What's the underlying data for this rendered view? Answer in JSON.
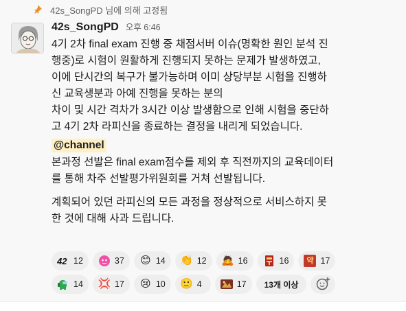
{
  "pinned": {
    "text": "42s_SongPD 님에 의해 고정됨"
  },
  "message": {
    "author": "42s_SongPD",
    "time": "오후 6:46",
    "paragraph1": "4기 2차 final exam 진행 중 채점서버 이슈(명확한 원인 분석 진\n행중)로 시험이 원활하게 진행되지 못하는 문제가 발생하였고,\n이에 단시간의 복구가 불가능하며 이미 상당부분 시험을 진행하\n신 교육생분과 아예 진행을 못하는 분의\n차이 및 시간 격차가 3시간 이상 발생함으로 인해 시험을 중단하\n고 4기 2차 라피신을 종료하는 결정을 내리게 되었습니다.",
    "mention": "@channel",
    "paragraph2": "본과정 선발은 final exam점수를 제외 후 직전까지의 교육데이터\n를 통해 차주 선발평가위원회를 거쳐 선발됩니다.",
    "paragraph3": "계획되어 있던 라피신의 모든 과정을 정상적으로 서비스하지 못\n한 것에 대해 사과 드립니다."
  },
  "reactions": [
    {
      "icon": "42-logo-icon",
      "glyph": "42",
      "count": "12"
    },
    {
      "icon": "pink-blob-icon",
      "glyph": "",
      "count": "37"
    },
    {
      "icon": "smile-icon",
      "glyph": "😊",
      "count": "14"
    },
    {
      "icon": "clap-icon",
      "glyph": "👏",
      "count": "12"
    },
    {
      "icon": "bowing-person-icon",
      "glyph": "🙇",
      "count": "16"
    },
    {
      "icon": "red-tag-icon",
      "glyph": "",
      "count": "16"
    },
    {
      "icon": "yak-badge-icon",
      "glyph": "약",
      "count": "17"
    },
    {
      "icon": "green-crewmate-icon",
      "glyph": "",
      "count": "14"
    },
    {
      "icon": "anger-icon",
      "glyph": "💢",
      "count": "17"
    },
    {
      "icon": "crying-face-icon",
      "glyph": "😢",
      "count": "10"
    },
    {
      "icon": "slight-smile-icon",
      "glyph": "🙂",
      "count": "4"
    },
    {
      "icon": "custom-image-icon",
      "glyph": "",
      "count": "17"
    }
  ],
  "more_reactions": "13개 이상",
  "add_reaction_icon": "add-reaction-icon",
  "colors": {
    "pin": "#e8912d",
    "mention_bg": "#fef0c4",
    "reaction_bg": "#eeeeee",
    "message_bg": "#f8f8f8"
  }
}
